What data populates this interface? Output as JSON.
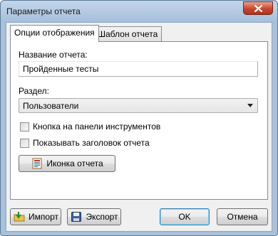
{
  "window": {
    "title": "Параметры отчета"
  },
  "tabs": [
    {
      "label": "Опции отображения",
      "active": true
    },
    {
      "label": "Шаблон отчета",
      "active": false
    }
  ],
  "form": {
    "name_label": "Название отчета:",
    "name_value": "Пройденные тесты",
    "section_label": "Раздел:",
    "section_value": "Пользователи",
    "checkbox_toolbar": {
      "label": "Кнопка на панели инструментов",
      "checked": false
    },
    "checkbox_header": {
      "label": "Показывать заголовок отчета",
      "checked": false
    },
    "icon_button_label": "Иконка отчета"
  },
  "footer": {
    "import_label": "Импорт",
    "export_label": "Экспорт",
    "ok_label": "OK",
    "cancel_label": "Отмена"
  },
  "colors": {
    "title_bar": "#a6bfdb",
    "close_button": "#c8452d",
    "dialog_bg": "#f0f0f0",
    "ok_border": "#3c7fb1"
  },
  "icons": {
    "close": "close-icon",
    "report": "report-icon",
    "import": "import-icon",
    "export": "save-icon"
  }
}
